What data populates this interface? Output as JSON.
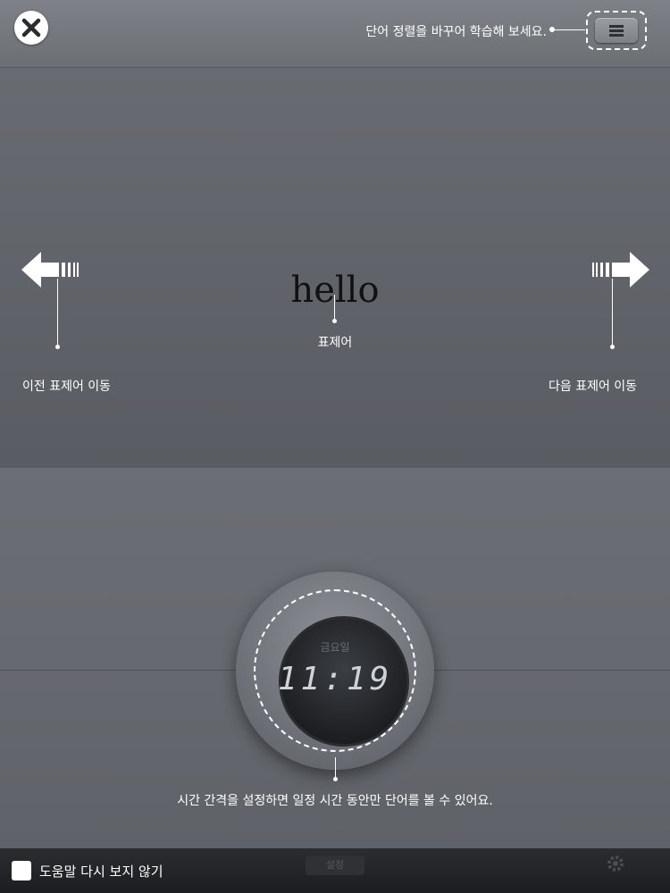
{
  "header": {
    "close_icon": "close-icon",
    "menu_icon": "hamburger-menu-icon",
    "sort_hint": "단어 정렬을 바꾸어 학습해 보세요."
  },
  "word_card": {
    "headword": "hello",
    "headword_label": "표제어",
    "prev_label": "이전 표제어 이동",
    "next_label": "다음 표제어 이동",
    "prev_icon": "arrow-left-icon",
    "next_icon": "arrow-right-icon"
  },
  "clock": {
    "day": "금요일",
    "time": "11:19",
    "hint": "시간 간격을 설정하면 일정 시간 동안만 단어를 볼 수 있어요."
  },
  "footer": {
    "checkbox_label": "도움말 다시 보지 않기",
    "checkbox_checked": false,
    "tab_label": "설정",
    "gear_icon": "gear-icon"
  },
  "colors": {
    "panel": "#5c5f66",
    "accent": "#ffffff",
    "headword": "#111111"
  }
}
